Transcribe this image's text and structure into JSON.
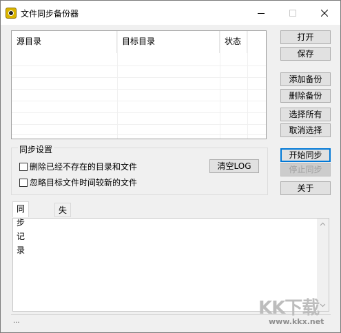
{
  "window": {
    "title": "文件同步备份器"
  },
  "list": {
    "columns": [
      "源目录",
      "目标目录",
      "状态"
    ]
  },
  "buttons": {
    "open": "打开",
    "save": "保存",
    "add_backup": "添加备份",
    "delete_backup": "删除备份",
    "select_all": "选择所有",
    "cancel_select": "取消选择",
    "start_sync": "开始同步",
    "stop_sync": "停止同步",
    "about": "关于",
    "clear_log": "清空LOG"
  },
  "sync_settings": {
    "title": "同步设置",
    "delete_nonexistent_label": "删除已经不存在的目录和文件",
    "delete_nonexistent_checked": false,
    "ignore_newer_label": "忽略目标文件时间较新的文件",
    "ignore_newer_checked": false
  },
  "tabs": [
    {
      "label": "同步记录",
      "active": true
    },
    {
      "label": "失败信息",
      "active": false
    }
  ],
  "status": {
    "text": "..."
  },
  "watermark": {
    "brand": "KK下载",
    "url": "www.kkx.net"
  }
}
